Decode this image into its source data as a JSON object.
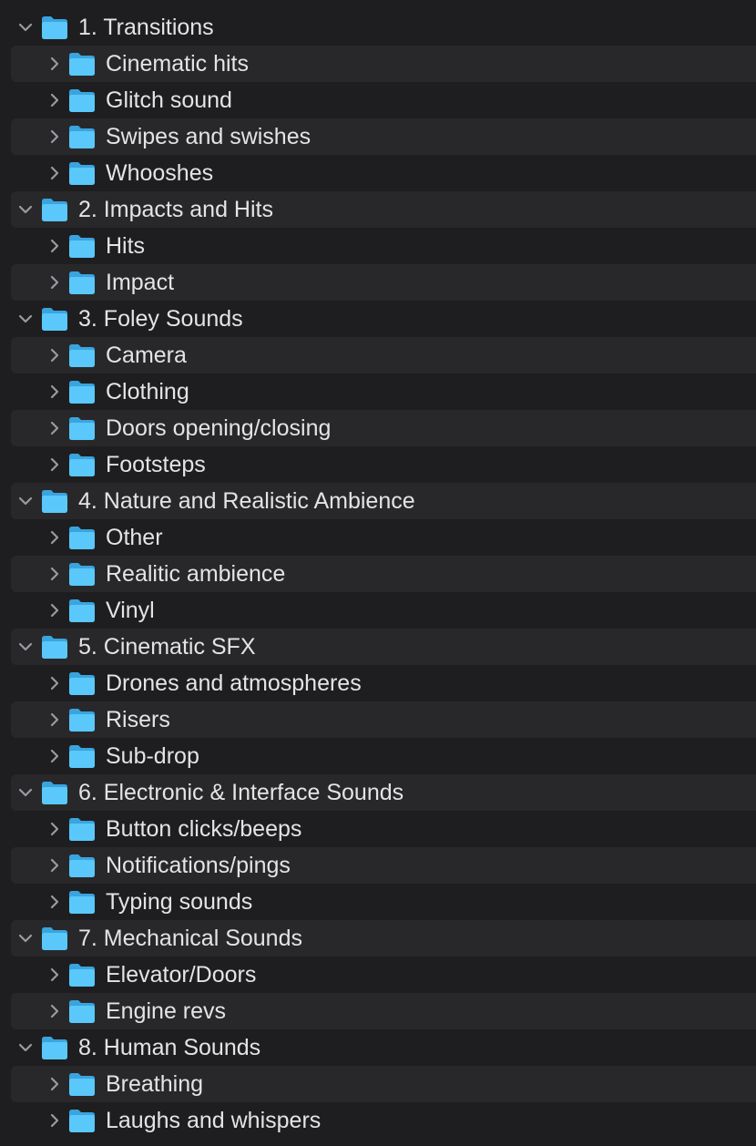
{
  "colors": {
    "background": "#1e1e20",
    "row_alt": "#28282b",
    "text": "#e4e4e6",
    "chevron": "#9a9aa0",
    "folder_front": "#5ac8fa",
    "folder_back": "#3aa4de"
  },
  "tree": [
    {
      "label": "1. Transitions",
      "level": 0,
      "expanded": true,
      "icon": "folder-icon"
    },
    {
      "label": "Cinematic hits",
      "level": 1,
      "expanded": false,
      "icon": "folder-icon"
    },
    {
      "label": "Glitch sound",
      "level": 1,
      "expanded": false,
      "icon": "folder-icon"
    },
    {
      "label": "Swipes and swishes",
      "level": 1,
      "expanded": false,
      "icon": "folder-icon"
    },
    {
      "label": "Whooshes",
      "level": 1,
      "expanded": false,
      "icon": "folder-icon"
    },
    {
      "label": "2. Impacts and Hits",
      "level": 0,
      "expanded": true,
      "icon": "folder-icon"
    },
    {
      "label": "Hits",
      "level": 1,
      "expanded": false,
      "icon": "folder-icon"
    },
    {
      "label": "Impact",
      "level": 1,
      "expanded": false,
      "icon": "folder-icon"
    },
    {
      "label": "3. Foley Sounds",
      "level": 0,
      "expanded": true,
      "icon": "folder-icon"
    },
    {
      "label": "Camera",
      "level": 1,
      "expanded": false,
      "icon": "folder-icon"
    },
    {
      "label": "Clothing",
      "level": 1,
      "expanded": false,
      "icon": "folder-icon"
    },
    {
      "label": "Doors opening/closing",
      "level": 1,
      "expanded": false,
      "icon": "folder-icon"
    },
    {
      "label": "Footsteps",
      "level": 1,
      "expanded": false,
      "icon": "folder-icon"
    },
    {
      "label": "4. Nature and Realistic Ambience",
      "level": 0,
      "expanded": true,
      "icon": "folder-icon"
    },
    {
      "label": "Other",
      "level": 1,
      "expanded": false,
      "icon": "folder-icon"
    },
    {
      "label": "Realitic ambience",
      "level": 1,
      "expanded": false,
      "icon": "folder-icon"
    },
    {
      "label": "Vinyl",
      "level": 1,
      "expanded": false,
      "icon": "folder-icon"
    },
    {
      "label": "5. Cinematic SFX",
      "level": 0,
      "expanded": true,
      "icon": "folder-icon"
    },
    {
      "label": "Drones and atmospheres",
      "level": 1,
      "expanded": false,
      "icon": "folder-icon"
    },
    {
      "label": "Risers",
      "level": 1,
      "expanded": false,
      "icon": "folder-icon"
    },
    {
      "label": "Sub-drop",
      "level": 1,
      "expanded": false,
      "icon": "folder-icon"
    },
    {
      "label": "6. Electronic & Interface Sounds",
      "level": 0,
      "expanded": true,
      "icon": "folder-icon"
    },
    {
      "label": "Button clicks/beeps",
      "level": 1,
      "expanded": false,
      "icon": "folder-icon"
    },
    {
      "label": "Notifications/pings",
      "level": 1,
      "expanded": false,
      "icon": "folder-icon"
    },
    {
      "label": "Typing sounds",
      "level": 1,
      "expanded": false,
      "icon": "folder-icon"
    },
    {
      "label": "7. Mechanical Sounds",
      "level": 0,
      "expanded": true,
      "icon": "folder-icon"
    },
    {
      "label": "Elevator/Doors",
      "level": 1,
      "expanded": false,
      "icon": "folder-icon"
    },
    {
      "label": "Engine revs",
      "level": 1,
      "expanded": false,
      "icon": "folder-icon"
    },
    {
      "label": "8. Human Sounds",
      "level": 0,
      "expanded": true,
      "icon": "folder-icon"
    },
    {
      "label": "Breathing",
      "level": 1,
      "expanded": false,
      "icon": "folder-icon"
    },
    {
      "label": "Laughs and whispers",
      "level": 1,
      "expanded": false,
      "icon": "folder-icon"
    }
  ]
}
